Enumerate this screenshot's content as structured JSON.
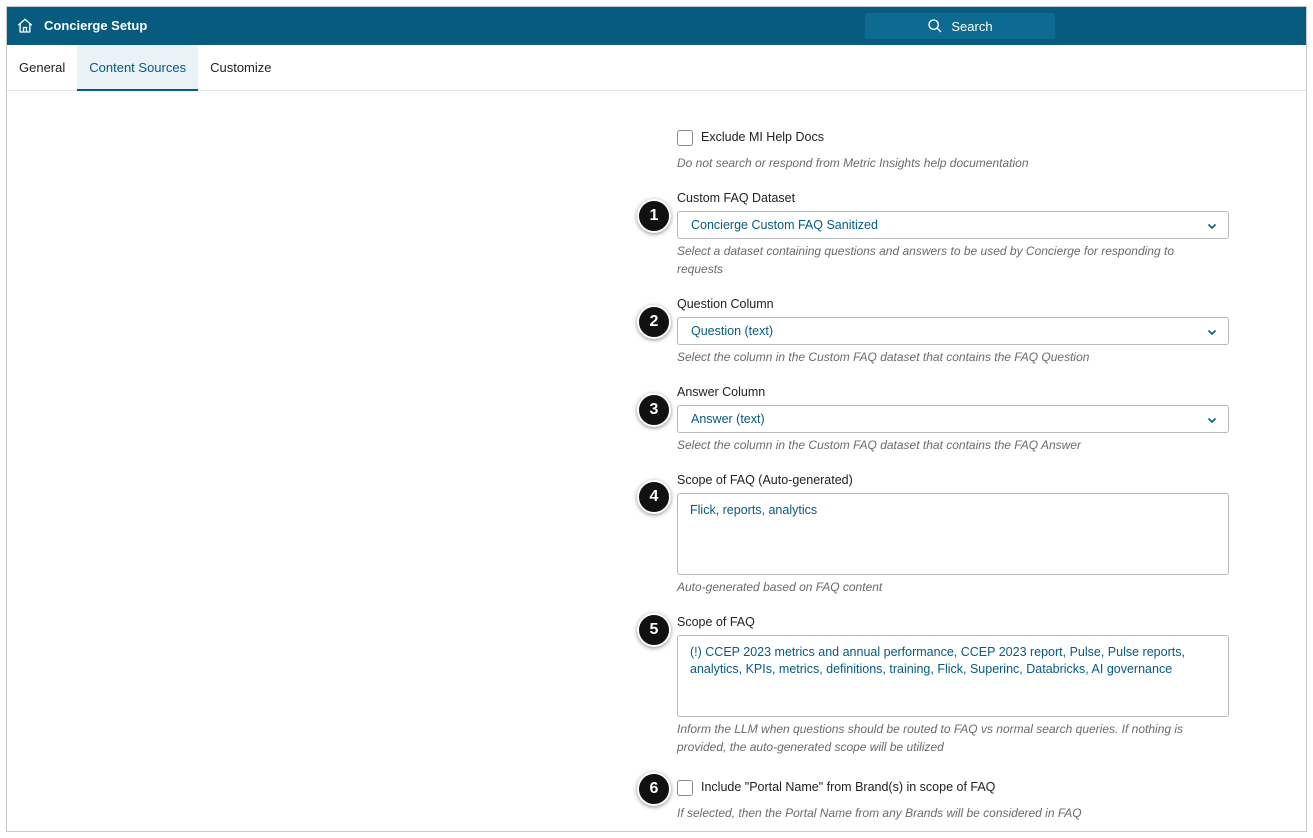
{
  "header": {
    "title": "Concierge Setup",
    "search_label": "Search"
  },
  "tabs": [
    {
      "label": "General",
      "active": false
    },
    {
      "label": "Content Sources",
      "active": true
    },
    {
      "label": "Customize",
      "active": false
    }
  ],
  "form": {
    "exclude_help": {
      "label": "Exclude MI Help Docs",
      "checked": false,
      "help": "Do not search or respond from Metric Insights help documentation"
    },
    "custom_faq_dataset": {
      "badge": "1",
      "label": "Custom FAQ Dataset",
      "value": "Concierge Custom FAQ Sanitized",
      "help": "Select a dataset containing questions and answers to be used by Concierge for responding to requests"
    },
    "question_column": {
      "badge": "2",
      "label": "Question Column",
      "value": "Question (text)",
      "help": "Select the column in the Custom FAQ dataset that contains the FAQ Question"
    },
    "answer_column": {
      "badge": "3",
      "label": "Answer Column",
      "value": "Answer (text)",
      "help": "Select the column in the Custom FAQ dataset that contains the FAQ Answer"
    },
    "scope_auto": {
      "badge": "4",
      "label": "Scope of FAQ (Auto-generated)",
      "value": "Flick, reports, analytics",
      "help": "Auto-generated based on FAQ content"
    },
    "scope": {
      "badge": "5",
      "label": "Scope of FAQ",
      "value": "(!) CCEP 2023 metrics and annual performance, CCEP 2023 report, Pulse, Pulse reports, analytics, KPIs, metrics, definitions, training, Flick, Superinc, Databricks, AI governance",
      "help": "Inform the LLM when questions should be routed to FAQ vs normal search queries. If nothing is provided, the auto-generated scope will be utilized"
    },
    "include_portal": {
      "badge": "6",
      "label": "Include \"Portal Name\" from Brand(s) in scope of FAQ",
      "checked": false,
      "help": "If selected, then the Portal Name from any Brands will be considered in FAQ"
    }
  },
  "colors": {
    "header_bg": "#075b7f",
    "accent": "#075b7f",
    "badge_bg": "#111111"
  }
}
